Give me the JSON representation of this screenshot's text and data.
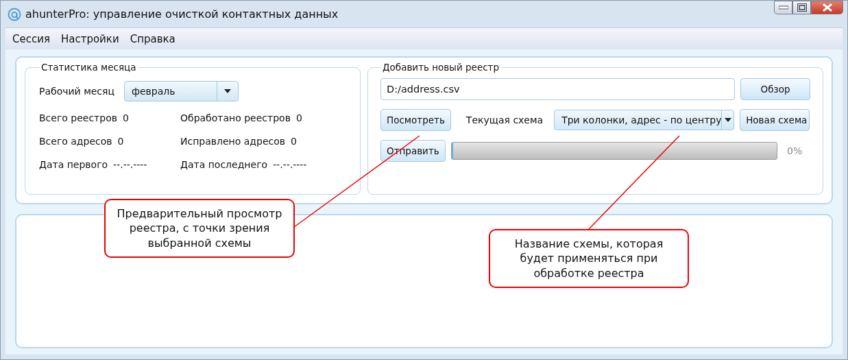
{
  "window": {
    "title": "ahunterPro: управление очисткой контактных данных"
  },
  "menu": [
    "Сессия",
    "Настройки",
    "Справка"
  ],
  "stats": {
    "title": "Статистика месяца",
    "month_label": "Рабочий месяц",
    "month_value": "февраль",
    "items": [
      {
        "label": "Всего реестров",
        "value": "0"
      },
      {
        "label": "Обработано реестров",
        "value": "0"
      },
      {
        "label": "Всего адресов",
        "value": "0"
      },
      {
        "label": "Исправлено адресов",
        "value": "0"
      },
      {
        "label": "Дата первого",
        "value": "--.--.----"
      },
      {
        "label": "Дата последнего",
        "value": "--.--.----"
      }
    ]
  },
  "add_registry": {
    "title": "Добавить новый реестр",
    "file_path": "D:/address.csv",
    "browse_button": "Обзор",
    "preview_button": "Посмотреть",
    "scheme_label": "Текущая схема",
    "scheme_value": "Три колонки, адрес - по центру",
    "new_scheme_button": "Новая схема",
    "send_button": "Отправить",
    "progress": {
      "level": 0,
      "reading": "0%"
    }
  },
  "callouts": [
    {
      "text": "Предварительный просмотр реестра, с точки зрения выбранной схемы"
    },
    {
      "text": "Название схемы, которая будет применяться при обработке реестра"
    }
  ]
}
